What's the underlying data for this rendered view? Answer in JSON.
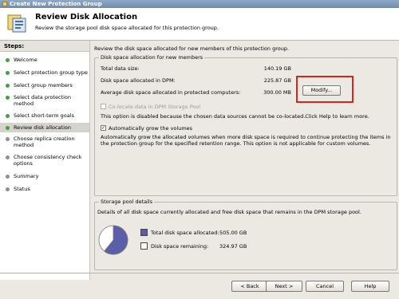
{
  "window": {
    "title": "Create New Protection Group"
  },
  "header": {
    "title": "Review Disk Allocation",
    "subtitle": "Review the storage pool disk space allocated for this protection group."
  },
  "sidebar": {
    "heading": "Steps:",
    "items": [
      {
        "label": "Welcome",
        "status": "done"
      },
      {
        "label": "Select protection group type",
        "status": "done"
      },
      {
        "label": "Select group members",
        "status": "done"
      },
      {
        "label": "Select data protection method",
        "status": "done"
      },
      {
        "label": "Select short-term goals",
        "status": "done"
      },
      {
        "label": "Review disk allocation",
        "status": "current"
      },
      {
        "label": "Choose replica creation method",
        "status": "pending"
      },
      {
        "label": "Choose consistency check options",
        "status": "pending"
      },
      {
        "label": "Summary",
        "status": "pending"
      },
      {
        "label": "Status",
        "status": "pending"
      }
    ]
  },
  "main": {
    "intro": "Review the disk space allocated for new members of this protection group.",
    "allocation": {
      "group_label": "Disk space allocation for new members",
      "total_label": "Total data size:",
      "total_value": "140.19 GB",
      "dpm_label": "Disk space allocated in DPM:",
      "dpm_value": "225.87 GB",
      "avg_label": "Average disk space allocated in protected computers:",
      "avg_value": "300.00 MB",
      "modify_label": "Modify...",
      "colocate_label": "Co-locate data in DPM Storage Pool",
      "colocate_checked": false,
      "colocate_note": "This option is disabled because the chosen data sources cannot be co-located.Click Help to learn more.",
      "autogrow_label": "Automatically grow the volumes",
      "autogrow_checked": true,
      "autogrow_desc": "Automatically grow the allocated volumes when more disk space is required to continue protecting the items in the protection group for the specified retention range. This option is not applicable for custom volumes."
    },
    "pool": {
      "group_label": "Storage pool details",
      "desc": "Details of all disk space currently allocated and free disk space that remains in the DPM storage pool.",
      "allocated_label": "Total disk space allocated:",
      "allocated_value": "505.00 GB",
      "remaining_label": "Disk space remaining:",
      "remaining_value": "324.97 GB",
      "allocated_fraction": 0.608,
      "colors": {
        "allocated": "#5b5fa8",
        "remaining": "#ffffff"
      }
    }
  },
  "footer": {
    "back": "< Back",
    "next": "Next >",
    "cancel": "Cancel",
    "help": "Help"
  }
}
